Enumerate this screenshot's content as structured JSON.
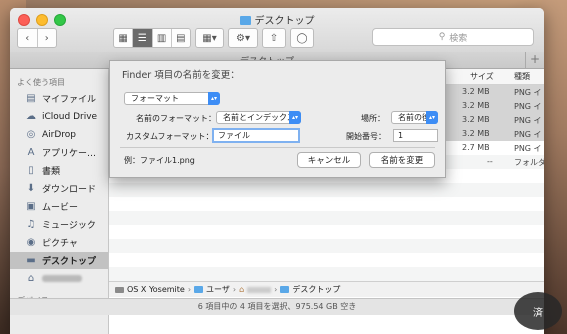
{
  "window": {
    "title": "デスクトップ"
  },
  "toolbar": {
    "search_placeholder": "検索"
  },
  "pathtab": {
    "label": "デスクトップ"
  },
  "sidebar": {
    "favorites_header": "よく使う項目",
    "items": [
      {
        "label": "マイファイル",
        "icon": "all-files-icon"
      },
      {
        "label": "iCloud Drive",
        "icon": "cloud-icon"
      },
      {
        "label": "AirDrop",
        "icon": "airdrop-icon"
      },
      {
        "label": "アプリケー…",
        "icon": "applications-icon"
      },
      {
        "label": "書類",
        "icon": "document-icon"
      },
      {
        "label": "ダウンロード",
        "icon": "download-icon"
      },
      {
        "label": "ムービー",
        "icon": "movie-icon"
      },
      {
        "label": "ミュージック",
        "icon": "music-icon"
      },
      {
        "label": "ピクチャ",
        "icon": "camera-icon"
      },
      {
        "label": "デスクトップ",
        "icon": "desktop-icon",
        "selected": true
      }
    ],
    "devices_header": "デバイス"
  },
  "columns": {
    "size": "サイズ",
    "kind": "種類"
  },
  "files": [
    {
      "size": "3.2 MB",
      "kind": "PNG イ",
      "selected": true
    },
    {
      "size": "3.2 MB",
      "kind": "PNG イ",
      "selected": true
    },
    {
      "size": "3.2 MB",
      "kind": "PNG イ",
      "selected": true
    },
    {
      "size": "3.2 MB",
      "kind": "PNG イ",
      "selected": true
    },
    {
      "size": "2.7 MB",
      "kind": "PNG イ",
      "selected": false
    },
    {
      "size": "--",
      "kind": "フォルダ",
      "selected": false
    }
  ],
  "rename_dialog": {
    "title": "Finder 項目の名前を変更：",
    "mode": "フォーマット",
    "name_format_label": "名前のフォーマット：",
    "name_format_value": "名前とインデックス",
    "location_label": "場所：",
    "location_value": "名前の後",
    "custom_format_label": "カスタムフォーマット：",
    "custom_format_value": "ファイル",
    "start_number_label": "開始番号：",
    "start_number_value": "1",
    "example": "例：ファイル1.png",
    "cancel_label": "キャンセル",
    "rename_label": "名前を変更"
  },
  "pathbar": {
    "items": [
      "OS X Yosemite",
      "ユーザ",
      "デスクトップ"
    ]
  },
  "status": "6 項目中の 4 項目を選択、975.54 GB 空き",
  "watermark": "済"
}
